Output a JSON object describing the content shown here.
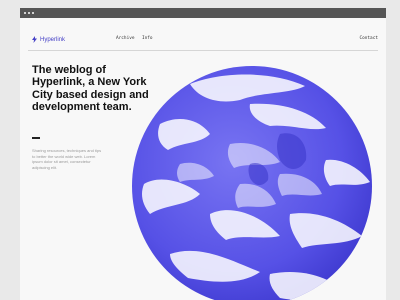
{
  "nav": {
    "brand": "Hyperlink",
    "links": [
      "Archive",
      "Info"
    ],
    "contact": "Contact"
  },
  "hero": {
    "heading": "The weblog of Hyperlink, a New York City based design and development team.",
    "blurb": "Sharing resources, techniques and tips to better the world wide web. Lorem ipsum dolor sit amet, consectetur adipiscing elit."
  },
  "colors": {
    "accent": "#4540c6",
    "globe": "#5b56e8",
    "text": "#111111"
  }
}
